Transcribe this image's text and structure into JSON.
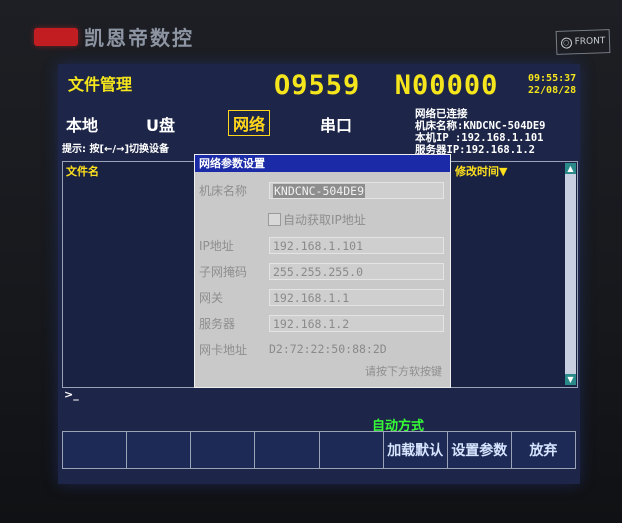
{
  "bezel": {
    "brand_name": "凯恩帝数控",
    "front_label": "FRONT",
    "front_icon": "circle-icon"
  },
  "header": {
    "title": "文件管理",
    "program_number": "O9559",
    "sequence_number": "N00000",
    "time": "09:55:37",
    "date": "22/08/28"
  },
  "tabs": [
    {
      "label": "本地",
      "active": false
    },
    {
      "label": "U盘",
      "active": false
    },
    {
      "label": "网络",
      "active": true
    },
    {
      "label": "串口",
      "active": false
    }
  ],
  "network_status": {
    "status": "网络已连接",
    "machine_name": "机床名称:KNDCNC-504DE9",
    "local_ip": "本机IP  :192.168.1.101",
    "server_ip": "服务器IP:192.168.1.2"
  },
  "hint": "提示: 按[←/→]切换设备",
  "file_list": {
    "col_name": "文件名",
    "col_time": "修改时间▼",
    "prompt": ">_"
  },
  "dialog": {
    "title": "网络参数设置",
    "machine_name_label": "机床名称",
    "machine_name": "KNDCNC-504DE9",
    "auto_ip_label": "自动获取IP地址",
    "auto_ip_checked": false,
    "ip_label": "IP地址",
    "ip": "192.168.1.101",
    "mask_label": "子网掩码",
    "mask": "255.255.255.0",
    "gateway_label": "网关",
    "gateway": "192.168.1.1",
    "server_label": "服务器",
    "server": "192.168.1.2",
    "mac_label": "网卡地址",
    "mac": "D2:72:22:50:88:2D",
    "footer_hint": "请按下方软按键"
  },
  "mode": "自动方式",
  "softkeys": [
    "",
    "",
    "",
    "",
    "",
    "加载默认",
    "设置参数",
    "放弃"
  ],
  "colors": {
    "screen_bg": "#1d2648",
    "yellow": "#f5e51c",
    "green": "#36ff36",
    "dialog_bg": "#c9c9c9",
    "dialog_title": "#1b2aa6"
  }
}
